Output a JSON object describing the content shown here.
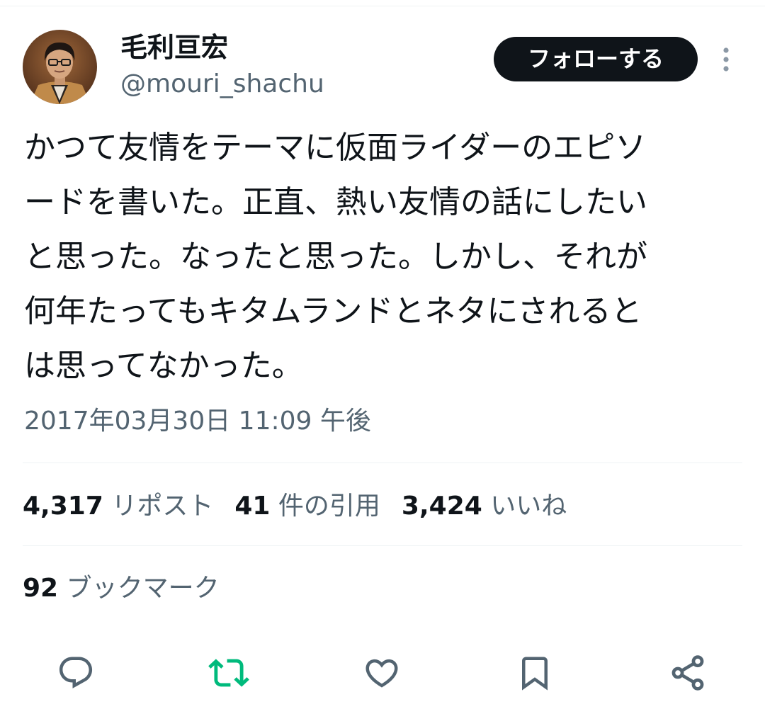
{
  "author": {
    "name": "毛利亘宏",
    "handle": "@mouri_shachu",
    "avatar_icon": "avatar-photo"
  },
  "follow_button": {
    "label": "フォローする"
  },
  "more_icon": "vertical-dots-icon",
  "tweet": {
    "lines": [
      "かつて友情をテーマに仮面ライダーのエピソ",
      "ードを書いた。正直、熱い友情の話にしたい",
      "と思った。なったと思った。しかし、それが",
      "何年たってもキタムランドとネタにされると",
      "は思ってなかった。"
    ]
  },
  "timestamp": "2017年03月30日 11:09 午後",
  "stats": {
    "reposts": {
      "count": "4,317",
      "label": "リポスト"
    },
    "quotes": {
      "count": "41",
      "label": "件の引用"
    },
    "likes": {
      "count": "3,424",
      "label": "いいね"
    },
    "bookmarks": {
      "count": "92",
      "label": "ブックマーク"
    }
  },
  "actions": [
    {
      "name": "reply",
      "icon": "reply-icon"
    },
    {
      "name": "repost",
      "icon": "repost-icon"
    },
    {
      "name": "like",
      "icon": "heart-icon"
    },
    {
      "name": "bookmark",
      "icon": "bookmark-icon"
    },
    {
      "name": "share",
      "icon": "share-icon"
    }
  ],
  "colors": {
    "text_primary": "#0f1419",
    "text_secondary": "#536471",
    "repost_green": "#00ba7c",
    "divider": "#eff3f4"
  }
}
